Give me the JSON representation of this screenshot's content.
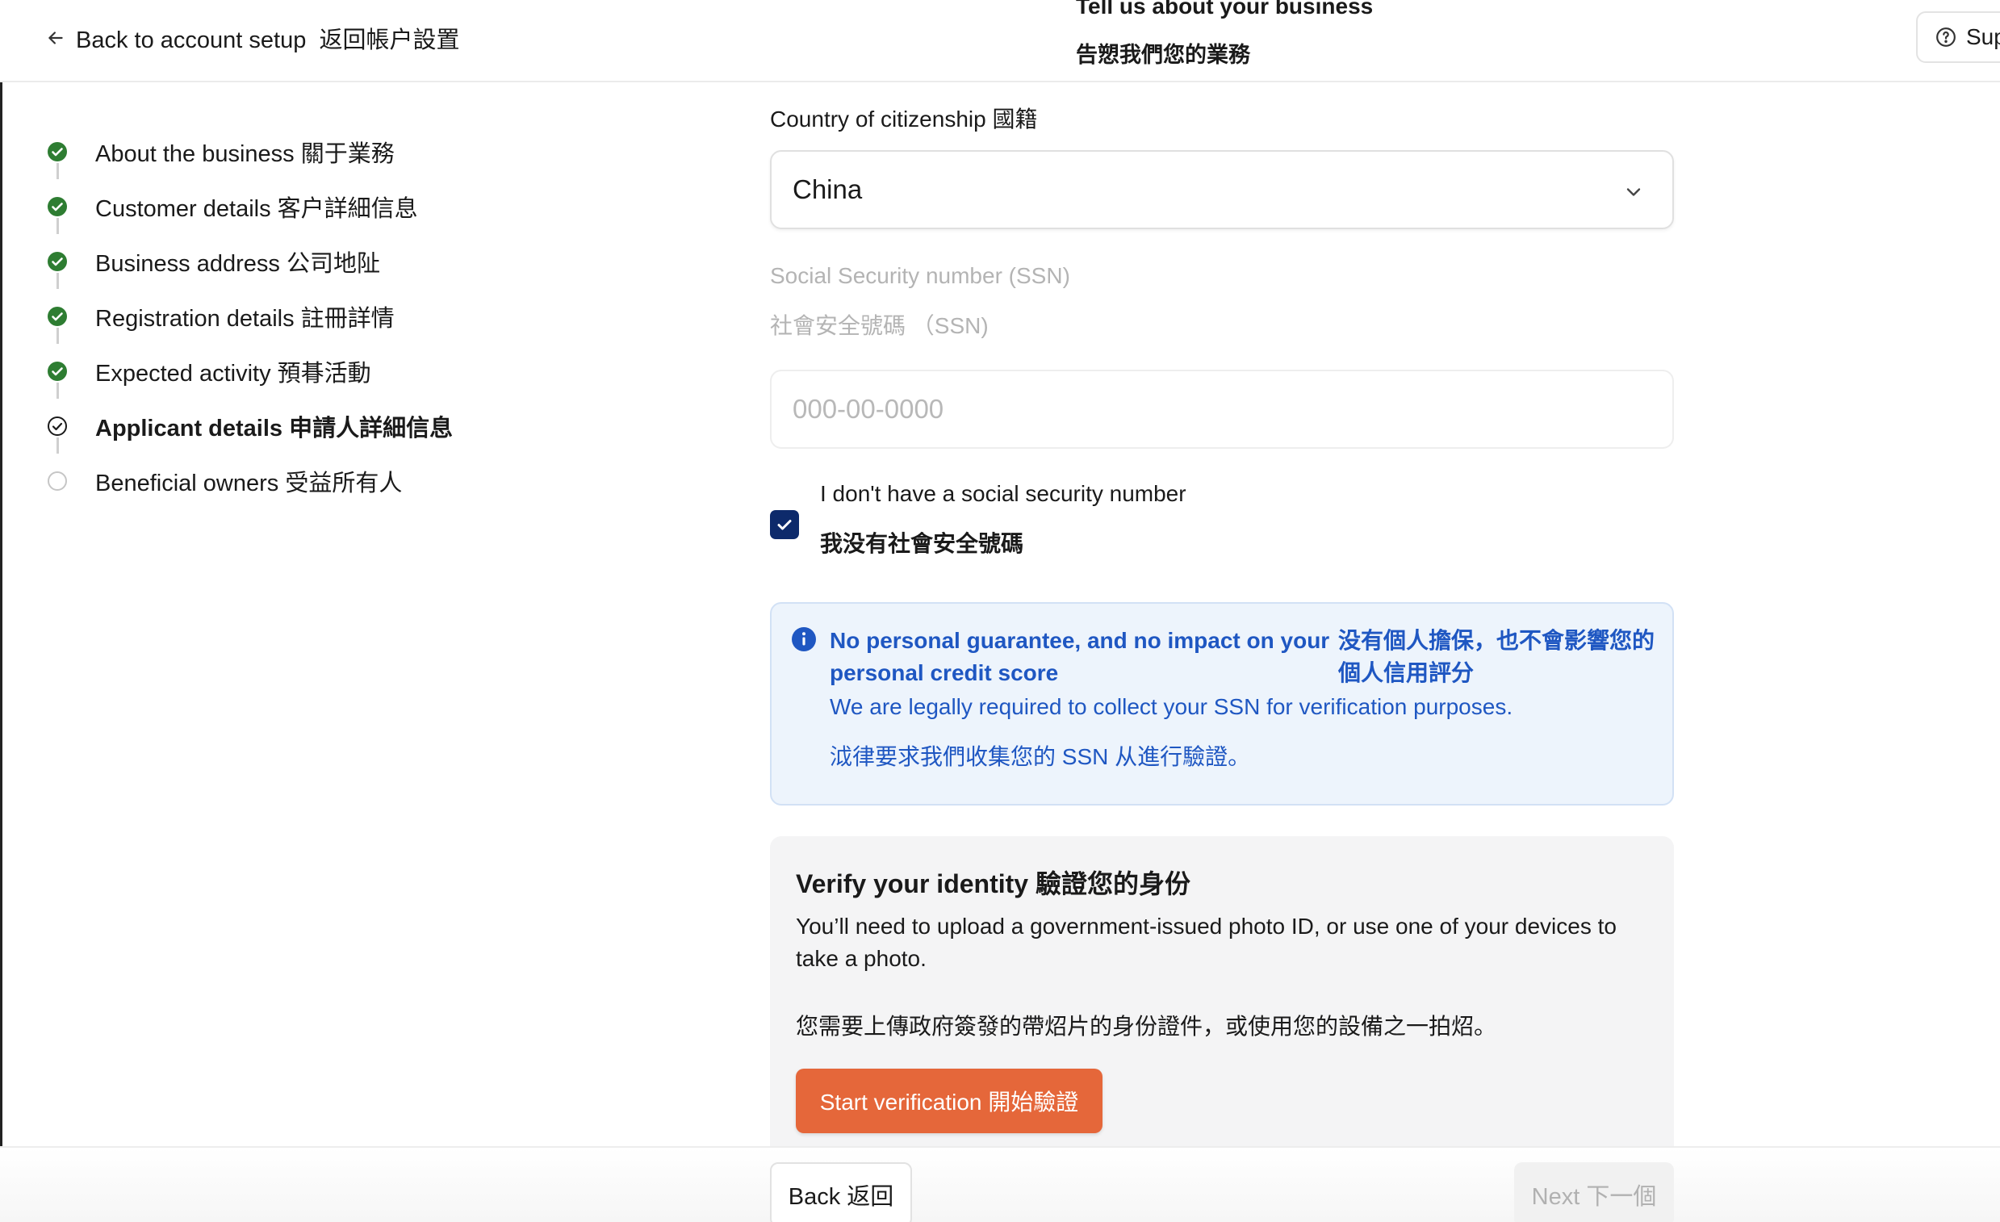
{
  "header": {
    "back_label": "Back to account setup  返回帳户設置",
    "title": "Tell us about your business",
    "subtitle": "告愬我們您的業務",
    "support_label": "Sup"
  },
  "sidebar": {
    "steps": [
      {
        "label": "About the business 關于業務",
        "status": "complete"
      },
      {
        "label": "Customer details 客户詳細信息",
        "status": "complete"
      },
      {
        "label": "Business address 公司地阯",
        "status": "complete"
      },
      {
        "label": "Registration details 註冊詳情",
        "status": "complete"
      },
      {
        "label": "Expected activity 預朞活動",
        "status": "complete"
      },
      {
        "label": "Applicant details 申請人詳細信息",
        "status": "current"
      },
      {
        "label": "Beneficial owners 受益所有人",
        "status": "pending"
      }
    ]
  },
  "form": {
    "citizenship_label": "Country of citizenship 國籍",
    "citizenship_value": "China",
    "ssn_label": "Social Security number (SSN)",
    "ssn_label_zh": "社會安全號碼 （SSN)",
    "ssn_placeholder": "000-00-0000",
    "no_ssn_label": "I don't have a social security number",
    "no_ssn_label_zh": "我没有社會安全號碼",
    "no_ssn_checked": true
  },
  "info_box": {
    "title": "No personal guarantee, and no impact on your personal credit score",
    "title_zh": "没有個人擔保，也不會影響您的個人信用評分",
    "text": "We are legally required to collect your SSN for verification purposes.",
    "text_zh": "泧律要求我們收集您的 SSN 从進行驗證。"
  },
  "verify": {
    "title": "Verify your identity 驗證您的身份",
    "text": "You’ll need to upload a government-issued photo ID, or use one of your devices to take a photo.",
    "text_zh": "您需要上傳政府簽發的帶炤片的身份證件，或使用您的設備之一拍炤。",
    "button_label": "Start verification 開始驗證"
  },
  "footer": {
    "back_label": "Back 返回",
    "next_label": "Next 下一個"
  },
  "colors": {
    "complete": "#2e7d32",
    "accent_blue": "#1f57c2",
    "checkbox": "#0d2a6b",
    "primary_button": "#e5673a"
  }
}
